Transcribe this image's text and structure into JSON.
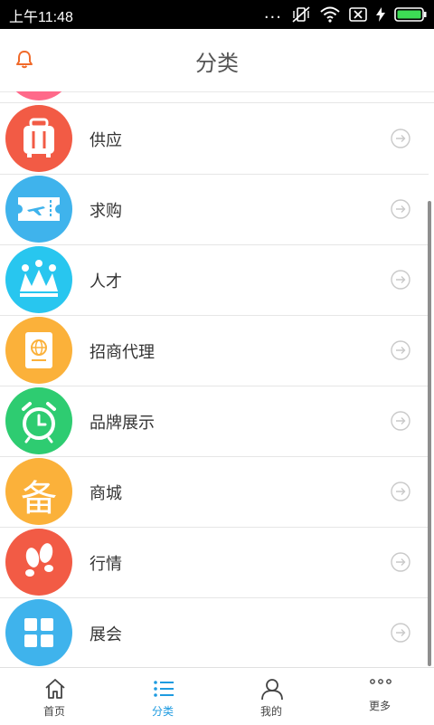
{
  "status_bar": {
    "time": "上午11:48",
    "dots": "..."
  },
  "header": {
    "title": "分类"
  },
  "categories": [
    {
      "label": "供应",
      "color": "#f25b45",
      "icon": "luggage-icon"
    },
    {
      "label": "求购",
      "color": "#3fb3ec",
      "icon": "ticket-plane-icon"
    },
    {
      "label": "人才",
      "color": "#28c6ef",
      "icon": "crown-icon"
    },
    {
      "label": "招商代理",
      "color": "#fbb13a",
      "icon": "passport-icon"
    },
    {
      "label": "品牌展示",
      "color": "#2ecc71",
      "icon": "alarm-clock-icon"
    },
    {
      "label": "商城",
      "color": "#fbb13a",
      "icon": "bei-character-icon",
      "glyph": "备"
    },
    {
      "label": "行情",
      "color": "#f25b45",
      "icon": "footprints-icon"
    },
    {
      "label": "展会",
      "color": "#3fb3ec",
      "icon": "grid-icon"
    }
  ],
  "tabbar": {
    "tabs": [
      {
        "label": "首页",
        "icon": "home-icon",
        "active": false
      },
      {
        "label": "分类",
        "icon": "list-icon",
        "active": true
      },
      {
        "label": "我的",
        "icon": "user-icon",
        "active": false
      },
      {
        "label": "更多",
        "icon": "more-icon",
        "active": false
      }
    ]
  },
  "colors": {
    "accent": "#1e9be0",
    "bell": "#f06a2a",
    "peek_circle": "#ff6a8a"
  }
}
